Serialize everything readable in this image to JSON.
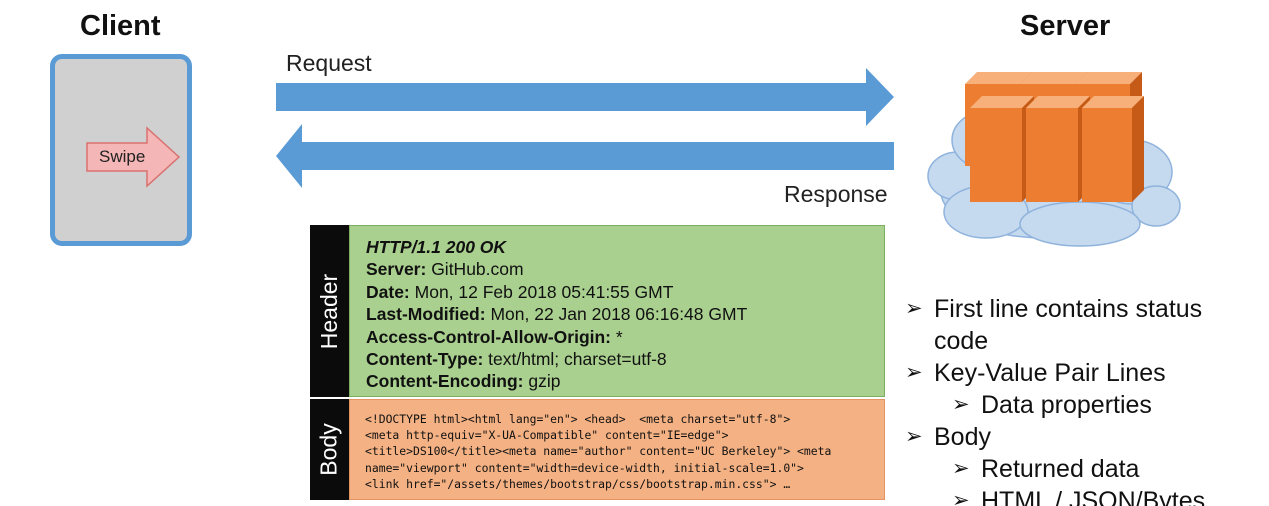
{
  "client": {
    "title": "Client",
    "swipe_label": "Swipe"
  },
  "server": {
    "title": "Server"
  },
  "arrows": {
    "request_label": "Request",
    "response_label": "Response"
  },
  "header": {
    "side_label": "Header",
    "lines": [
      {
        "key": "HTTP/1.1 200 OK",
        "value": ""
      },
      {
        "key": "Server:",
        "value": " GitHub.com"
      },
      {
        "key": "Date:",
        "value": " Mon, 12 Feb 2018 05:41:55 GMT"
      },
      {
        "key": "Last-Modified:",
        "value": " Mon, 22 Jan 2018 06:16:48 GMT"
      },
      {
        "key": "Access-Control-Allow-Origin:",
        "value": " *"
      },
      {
        "key": "Content-Type:",
        "value": " text/html; charset=utf-8"
      },
      {
        "key": "Content-Encoding:",
        "value": " gzip"
      }
    ]
  },
  "body": {
    "side_label": "Body",
    "lines": [
      "<!DOCTYPE html><html lang=\"en\"> <head>  <meta charset=\"utf-8\">",
      "<meta http-equiv=\"X-UA-Compatible\" content=\"IE=edge\">",
      "<title>DS100</title><meta name=\"author\" content=\"UC Berkeley\"> <meta",
      "name=\"viewport\" content=\"width=device-width, initial-scale=1.0\">",
      "<link href=\"/assets/themes/bootstrap/css/bootstrap.min.css\"> …"
    ]
  },
  "bullets": [
    {
      "level": 1,
      "text": "First line contains status"
    },
    {
      "level": 1,
      "text": "code",
      "continuation": true
    },
    {
      "level": 1,
      "text": "Key-Value Pair Lines"
    },
    {
      "level": 2,
      "text": "Data properties"
    },
    {
      "level": 1,
      "text": "Body"
    },
    {
      "level": 2,
      "text": "Returned data"
    },
    {
      "level": 2,
      "text": "HTML / JSON/Bytes"
    }
  ],
  "colors": {
    "arrow": "#5b9bd5",
    "header_fill": "#a9d08e",
    "body_fill": "#f4b183",
    "swipe_fill": "#f4b6b6",
    "server_orange": "#ed7d31",
    "cloud": "#c5d9ef"
  }
}
